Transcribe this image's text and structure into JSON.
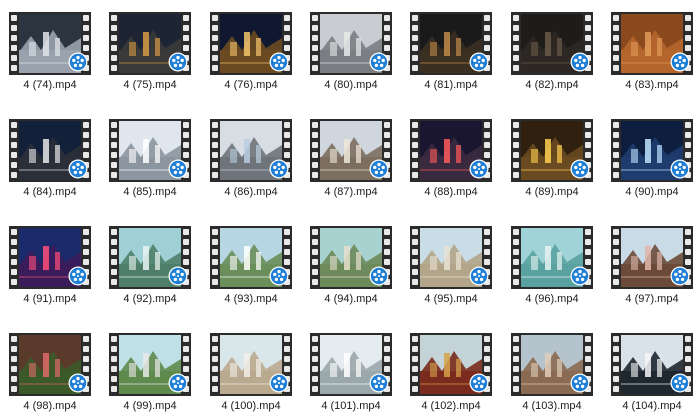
{
  "view": "large-icons",
  "player_badge_icon": "media-player-reel-icon",
  "player_badge_color": "#1f7fd6",
  "files": [
    {
      "name": "4 (74).mp4",
      "thumb": {
        "sky": "#2a3540",
        "ground": "#9aa3ad",
        "accent": "#dfe4ea"
      }
    },
    {
      "name": "4 (75).mp4",
      "thumb": {
        "sky": "#1d2433",
        "ground": "#3a3a3a",
        "accent": "#d89a45"
      }
    },
    {
      "name": "4 (76).mp4",
      "thumb": {
        "sky": "#0f1830",
        "ground": "#6b4a22",
        "accent": "#f3c46a"
      }
    },
    {
      "name": "4 (80).mp4",
      "thumb": {
        "sky": "#c9ccd0",
        "ground": "#7a7d82",
        "accent": "#e8e8e8"
      }
    },
    {
      "name": "4 (81).mp4",
      "thumb": {
        "sky": "#1a1a1a",
        "ground": "#3b2f22",
        "accent": "#c08a4a"
      }
    },
    {
      "name": "4 (82).mp4",
      "thumb": {
        "sky": "#1e1c1a",
        "ground": "#2d2824",
        "accent": "#6a5a48"
      }
    },
    {
      "name": "4 (83).mp4",
      "thumb": {
        "sky": "#8a4a1e",
        "ground": "#b5662c",
        "accent": "#e09a58"
      }
    },
    {
      "name": "4 (84).mp4",
      "thumb": {
        "sky": "#13203a",
        "ground": "#2a2f3a",
        "accent": "#e6e6e6"
      }
    },
    {
      "name": "4 (85).mp4",
      "thumb": {
        "sky": "#dfe6ee",
        "ground": "#8c96a0",
        "accent": "#ffffff"
      }
    },
    {
      "name": "4 (86).mp4",
      "thumb": {
        "sky": "#d7dde3",
        "ground": "#6f747a",
        "accent": "#b8cde0"
      }
    },
    {
      "name": "4 (87).mp4",
      "thumb": {
        "sky": "#cfd6de",
        "ground": "#7c6f60",
        "accent": "#efe7da"
      }
    },
    {
      "name": "4 (88).mp4",
      "thumb": {
        "sky": "#1a1530",
        "ground": "#3a2a40",
        "accent": "#ff5a5a"
      }
    },
    {
      "name": "4 (89).mp4",
      "thumb": {
        "sky": "#302010",
        "ground": "#6a4a20",
        "accent": "#ffcf50"
      }
    },
    {
      "name": "4 (90).mp4",
      "thumb": {
        "sky": "#0e1e3e",
        "ground": "#1f3c6e",
        "accent": "#bfe3ff"
      }
    },
    {
      "name": "4 (91).mp4",
      "thumb": {
        "sky": "#1a2a6a",
        "ground": "#3b1c5a",
        "accent": "#ff4f7a"
      }
    },
    {
      "name": "4 (92).mp4",
      "thumb": {
        "sky": "#9fd0d6",
        "ground": "#4f7f6a",
        "accent": "#e9f3f2"
      }
    },
    {
      "name": "4 (93).mp4",
      "thumb": {
        "sky": "#b7d6e3",
        "ground": "#6a8f5a",
        "accent": "#ffffff"
      }
    },
    {
      "name": "4 (94).mp4",
      "thumb": {
        "sky": "#a8d2cf",
        "ground": "#6d8a5a",
        "accent": "#e6e0cf"
      }
    },
    {
      "name": "4 (95).mp4",
      "thumb": {
        "sky": "#c8dde6",
        "ground": "#b3a58a",
        "accent": "#e9e2d3"
      }
    },
    {
      "name": "4 (96).mp4",
      "thumb": {
        "sky": "#9fd3d8",
        "ground": "#5aa2a0",
        "accent": "#e6f3f1"
      }
    },
    {
      "name": "4 (97).mp4",
      "thumb": {
        "sky": "#c9dbe6",
        "ground": "#6b4a3a",
        "accent": "#e0b7a8"
      }
    },
    {
      "name": "4 (98).mp4",
      "thumb": {
        "sky": "#5a3a2a",
        "ground": "#3b5a2a",
        "accent": "#e06a6a"
      }
    },
    {
      "name": "4 (99).mp4",
      "thumb": {
        "sky": "#bfe0e6",
        "ground": "#5f8a4e",
        "accent": "#e8e8e8"
      }
    },
    {
      "name": "4 (100).mp4",
      "thumb": {
        "sky": "#d9e6ea",
        "ground": "#b9a98f",
        "accent": "#f2efe8"
      }
    },
    {
      "name": "4 (101).mp4",
      "thumb": {
        "sky": "#e4ecef",
        "ground": "#9aa7ab",
        "accent": "#ffffff"
      }
    },
    {
      "name": "4 (102).mp4",
      "thumb": {
        "sky": "#c4d3d8",
        "ground": "#7a2b1e",
        "accent": "#d7a24a"
      }
    },
    {
      "name": "4 (103).mp4",
      "thumb": {
        "sky": "#b5c4cc",
        "ground": "#8a6a52",
        "accent": "#e0cdb8"
      }
    },
    {
      "name": "4 (104).mp4",
      "thumb": {
        "sky": "#d8e2e8",
        "ground": "#1f2730",
        "accent": "#f4f6f8"
      }
    }
  ]
}
